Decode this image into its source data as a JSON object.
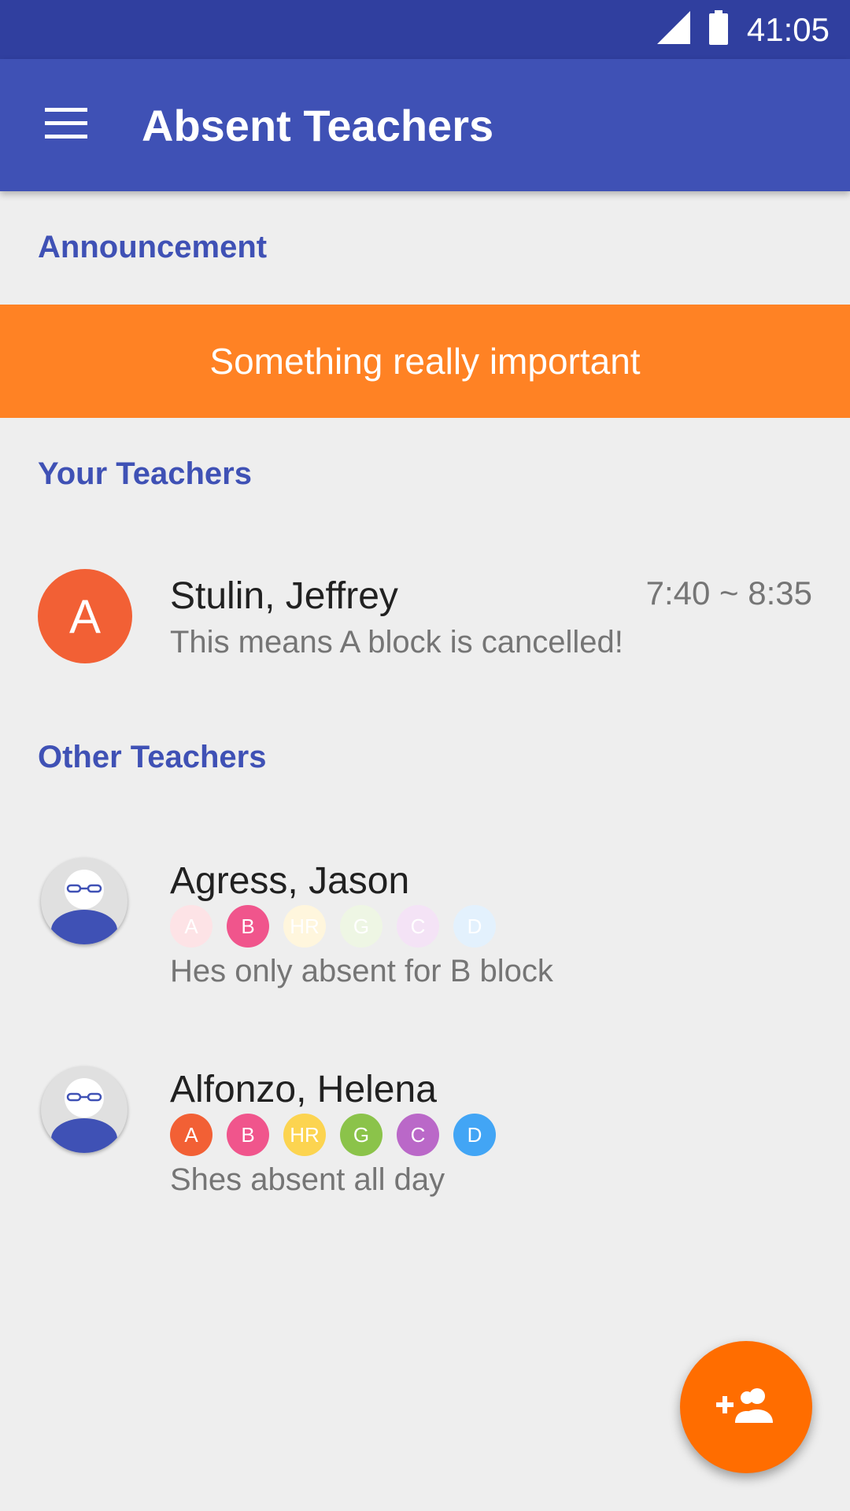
{
  "status_bar": {
    "time": "41:05",
    "signal_icon": "cell-signal-icon",
    "battery_icon": "battery-icon"
  },
  "app_bar": {
    "menu_icon": "hamburger-menu-icon",
    "title": "Absent Teachers"
  },
  "announcement_section": {
    "header": "Announcement",
    "message": "Something really important"
  },
  "your_teachers": {
    "header": "Your Teachers",
    "items": [
      {
        "avatar_letter": "A",
        "name": "Stulin, Jeffrey",
        "time": "7:40 ~ 8:35",
        "note": "This means A block is cancelled!"
      }
    ]
  },
  "other_teachers": {
    "header": "Other Teachers",
    "items": [
      {
        "name": "Agress, Jason",
        "note": "Hes only absent for B block",
        "blocks": [
          {
            "label": "A",
            "active": false
          },
          {
            "label": "B",
            "active": true
          },
          {
            "label": "HR",
            "active": false
          },
          {
            "label": "G",
            "active": false
          },
          {
            "label": "C",
            "active": false
          },
          {
            "label": "D",
            "active": false
          }
        ]
      },
      {
        "name": "Alfonzo, Helena",
        "note": "Shes absent all day",
        "blocks": [
          {
            "label": "A",
            "active": true
          },
          {
            "label": "B",
            "active": true
          },
          {
            "label": "HR",
            "active": true
          },
          {
            "label": "G",
            "active": true
          },
          {
            "label": "C",
            "active": true
          },
          {
            "label": "D",
            "active": true
          }
        ]
      }
    ]
  },
  "block_colors": {
    "A": "#f26035",
    "B": "#f0558c",
    "HR": "#fcd450",
    "G": "#8bc34a",
    "C": "#ba68c8",
    "D": "#42a5f5"
  },
  "block_faded_colors": {
    "A": "#fde3e6",
    "B": "#fce4ec",
    "HR": "#fff6dd",
    "G": "#eef6e4",
    "C": "#f4e3f6",
    "D": "#e3f1fd"
  },
  "fab": {
    "icon": "add-group-icon"
  },
  "colors": {
    "primary": "#3f51b5",
    "primary_dark": "#303f9f",
    "accent": "#ff6d00",
    "announcement_bg": "#ff8224"
  }
}
